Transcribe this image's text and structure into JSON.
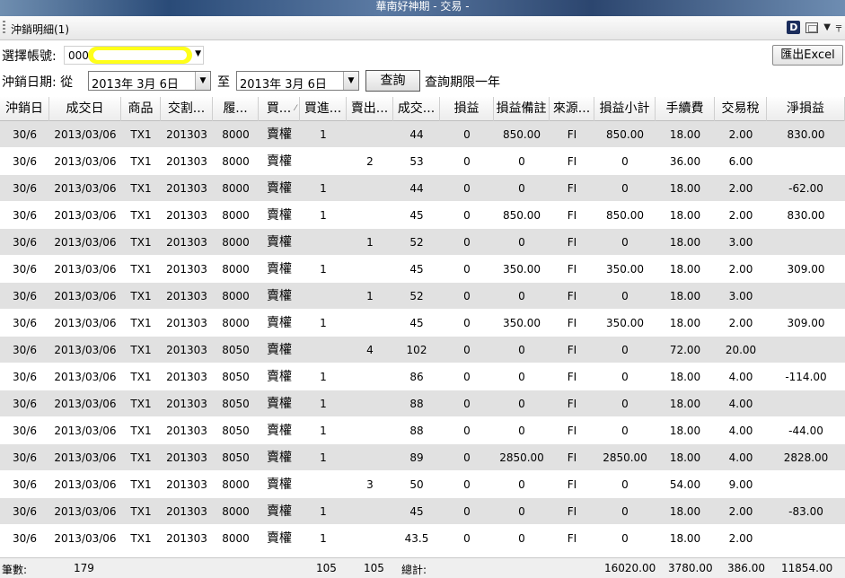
{
  "window": {
    "title": "華南好神期 - 交易 -"
  },
  "tab": {
    "label": "沖銷明細(1)"
  },
  "account": {
    "label": "選擇帳號:",
    "value": "000"
  },
  "export": {
    "label": "匯出Excel"
  },
  "date_filter": {
    "label": "沖銷日期: 從",
    "from": "2013年  3月  6日",
    "to_label": "至",
    "to": "2013年  3月  6日",
    "query_label": "查詢",
    "limit_note": "查詢期限一年"
  },
  "columns": [
    "沖銷日",
    "成交日",
    "商品",
    "交割...",
    "履...",
    "買...",
    "買進...",
    "賣出...",
    "成交...",
    "損益",
    "損益備註",
    "來源...",
    "損益小計",
    "手續費",
    "交易稅",
    "淨損益"
  ],
  "rows": [
    [
      "30/6",
      "2013/03/06",
      "TX1",
      "201303",
      "8000",
      "賣權",
      "1",
      "",
      "44",
      "0",
      "850.00",
      "FI",
      "850.00",
      "18.00",
      "2.00",
      "830.00"
    ],
    [
      "30/6",
      "2013/03/06",
      "TX1",
      "201303",
      "8000",
      "賣權",
      "",
      "2",
      "53",
      "0",
      "0",
      "FI",
      "0",
      "36.00",
      "6.00",
      ""
    ],
    [
      "30/6",
      "2013/03/06",
      "TX1",
      "201303",
      "8000",
      "賣權",
      "1",
      "",
      "44",
      "0",
      "0",
      "FI",
      "0",
      "18.00",
      "2.00",
      "-62.00"
    ],
    [
      "30/6",
      "2013/03/06",
      "TX1",
      "201303",
      "8000",
      "賣權",
      "1",
      "",
      "45",
      "0",
      "850.00",
      "FI",
      "850.00",
      "18.00",
      "2.00",
      "830.00"
    ],
    [
      "30/6",
      "2013/03/06",
      "TX1",
      "201303",
      "8000",
      "賣權",
      "",
      "1",
      "52",
      "0",
      "0",
      "FI",
      "0",
      "18.00",
      "3.00",
      ""
    ],
    [
      "30/6",
      "2013/03/06",
      "TX1",
      "201303",
      "8000",
      "賣權",
      "1",
      "",
      "45",
      "0",
      "350.00",
      "FI",
      "350.00",
      "18.00",
      "2.00",
      "309.00"
    ],
    [
      "30/6",
      "2013/03/06",
      "TX1",
      "201303",
      "8000",
      "賣權",
      "",
      "1",
      "52",
      "0",
      "0",
      "FI",
      "0",
      "18.00",
      "3.00",
      ""
    ],
    [
      "30/6",
      "2013/03/06",
      "TX1",
      "201303",
      "8000",
      "賣權",
      "1",
      "",
      "45",
      "0",
      "350.00",
      "FI",
      "350.00",
      "18.00",
      "2.00",
      "309.00"
    ],
    [
      "30/6",
      "2013/03/06",
      "TX1",
      "201303",
      "8050",
      "賣權",
      "",
      "4",
      "102",
      "0",
      "0",
      "FI",
      "0",
      "72.00",
      "20.00",
      ""
    ],
    [
      "30/6",
      "2013/03/06",
      "TX1",
      "201303",
      "8050",
      "賣權",
      "1",
      "",
      "86",
      "0",
      "0",
      "FI",
      "0",
      "18.00",
      "4.00",
      "-114.00"
    ],
    [
      "30/6",
      "2013/03/06",
      "TX1",
      "201303",
      "8050",
      "賣權",
      "1",
      "",
      "88",
      "0",
      "0",
      "FI",
      "0",
      "18.00",
      "4.00",
      ""
    ],
    [
      "30/6",
      "2013/03/06",
      "TX1",
      "201303",
      "8050",
      "賣權",
      "1",
      "",
      "88",
      "0",
      "0",
      "FI",
      "0",
      "18.00",
      "4.00",
      "-44.00"
    ],
    [
      "30/6",
      "2013/03/06",
      "TX1",
      "201303",
      "8050",
      "賣權",
      "1",
      "",
      "89",
      "0",
      "2850.00",
      "FI",
      "2850.00",
      "18.00",
      "4.00",
      "2828.00"
    ],
    [
      "30/6",
      "2013/03/06",
      "TX1",
      "201303",
      "8000",
      "賣權",
      "",
      "3",
      "50",
      "0",
      "0",
      "FI",
      "0",
      "54.00",
      "9.00",
      ""
    ],
    [
      "30/6",
      "2013/03/06",
      "TX1",
      "201303",
      "8000",
      "賣權",
      "1",
      "",
      "45",
      "0",
      "0",
      "FI",
      "0",
      "18.00",
      "2.00",
      "-83.00"
    ],
    [
      "30/6",
      "2013/03/06",
      "TX1",
      "201303",
      "8000",
      "賣權",
      "1",
      "",
      "43.5",
      "0",
      "0",
      "FI",
      "0",
      "18.00",
      "2.00",
      ""
    ]
  ],
  "footer": {
    "count_label": "筆數:",
    "count": "179",
    "buy_total": "105",
    "sell_total": "105",
    "total_label": "總計:",
    "subtotal": "16020.00",
    "fee_total": "3780.00",
    "tax_total": "386.00",
    "net_total": "11854.00"
  }
}
